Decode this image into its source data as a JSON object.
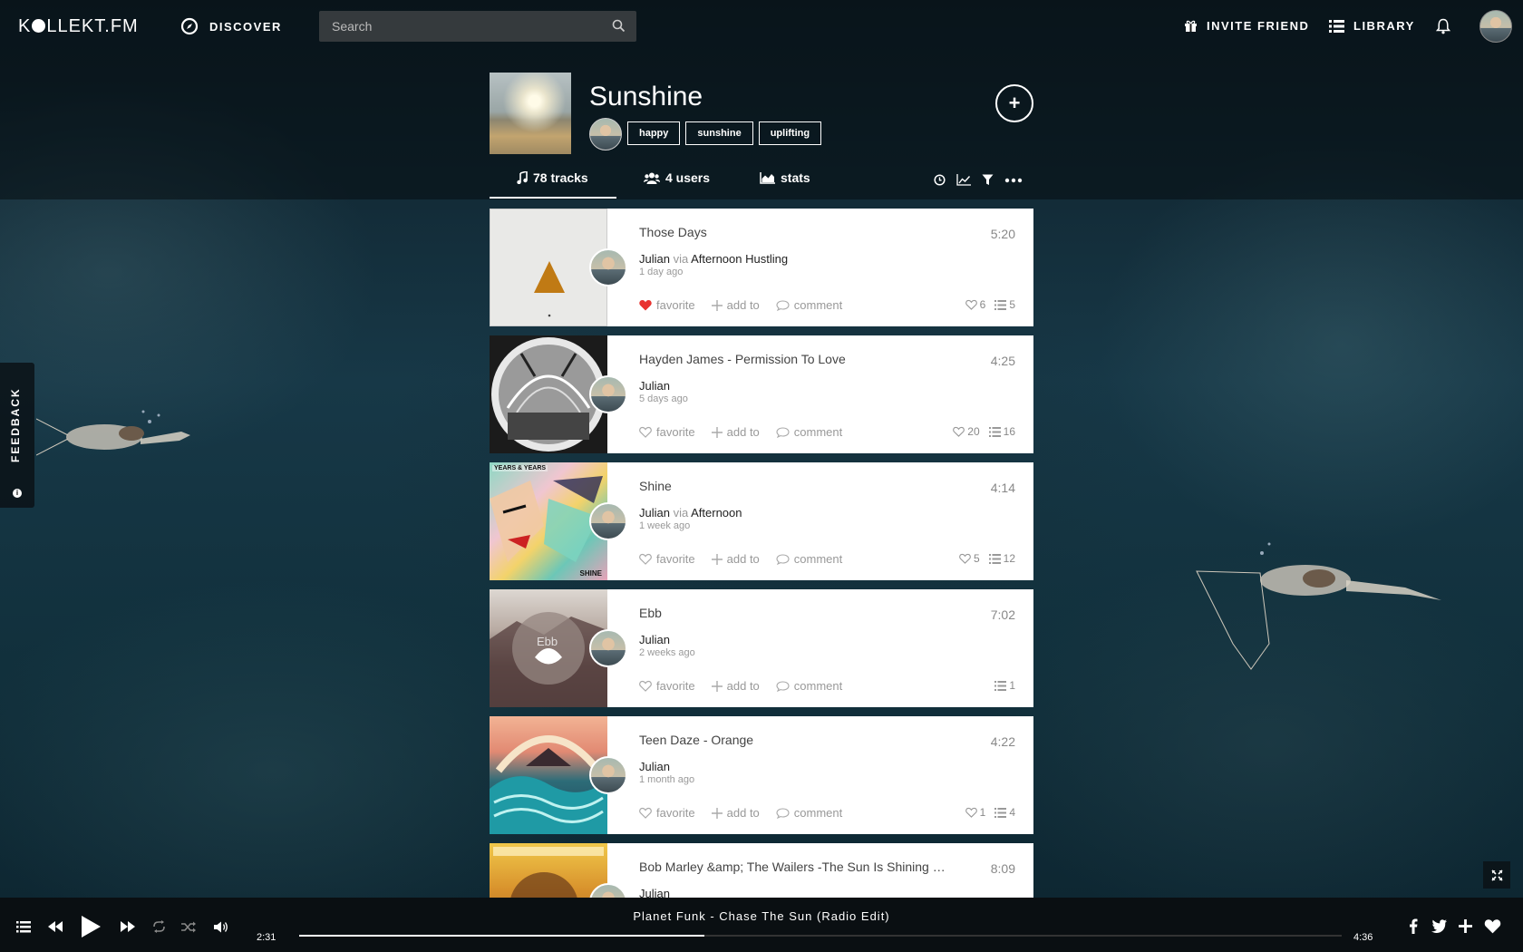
{
  "nav": {
    "logo_pre": "K",
    "logo_post": "LLEKT.FM",
    "discover_label": "DISCOVER",
    "search_placeholder": "Search",
    "invite_label": "INVITE FRIEND",
    "library_label": "LIBRARY"
  },
  "playlist": {
    "title": "Sunshine",
    "tags": [
      "happy",
      "sunshine",
      "uplifting"
    ],
    "add_label": "+"
  },
  "tabs": {
    "tracks": "78 tracks",
    "users": "4 users",
    "stats": "stats"
  },
  "tracks": [
    {
      "title": "Those Days",
      "duration": "5:20",
      "user": "Julian",
      "via": "via",
      "source": "Afternoon Hustling",
      "ago": "1 day ago",
      "favorited": true,
      "likes": "6",
      "lists": "5"
    },
    {
      "title": "Hayden James - Permission To Love",
      "duration": "4:25",
      "user": "Julian",
      "via": "",
      "source": "",
      "ago": "5 days ago",
      "favorited": false,
      "likes": "20",
      "lists": "16"
    },
    {
      "title": "Shine",
      "duration": "4:14",
      "user": "Julian",
      "via": "via",
      "source": "Afternoon",
      "ago": "1 week ago",
      "favorited": false,
      "likes": "5",
      "lists": "12"
    },
    {
      "title": "Ebb",
      "duration": "7:02",
      "user": "Julian",
      "via": "",
      "source": "",
      "ago": "2 weeks ago",
      "favorited": false,
      "likes": "",
      "lists": "1"
    },
    {
      "title": "Teen Daze - Orange",
      "duration": "4:22",
      "user": "Julian",
      "via": "",
      "source": "",
      "ago": "1 month ago",
      "favorited": false,
      "likes": "1",
      "lists": "4"
    },
    {
      "title": "Bob Marley &amp; The Wailers -The Sun Is Shining (Fu...",
      "duration": "8:09",
      "user": "Julian",
      "via": "",
      "source": "",
      "ago": "",
      "favorited": false,
      "likes": "",
      "lists": ""
    }
  ],
  "actions": {
    "favorite": "favorite",
    "add_to": "add to",
    "comment": "comment"
  },
  "art_text": {
    "shine_top": "YEARS & YEARS",
    "shine_bottom": "SHINE",
    "ebb": "Ebb"
  },
  "feedback_label": "FEEDBACK",
  "player": {
    "now_playing": "Planet Funk - Chase The Sun (Radio Edit)",
    "elapsed": "2:31",
    "total": "4:36",
    "progress": 0.389
  },
  "colors": {
    "favorite_red": "#e8322f",
    "card_bg": "#ffffff",
    "player_bg": "#0a0f12"
  }
}
